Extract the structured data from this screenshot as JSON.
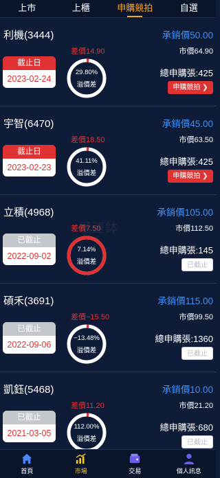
{
  "tabs": [
    {
      "label": "上市",
      "active": false
    },
    {
      "label": "上櫃",
      "active": false
    },
    {
      "label": "申購競拍",
      "active": true
    },
    {
      "label": "自選",
      "active": false
    }
  ],
  "labels": {
    "diff_prefix": "差價",
    "underwrite_prefix": "承銷價",
    "market_prefix": "市價",
    "total_prefix": "總申購張:",
    "ring_caption": "溢價差",
    "bid_button": "申購競拍 ❯",
    "closed_button": "已截止"
  },
  "watermark": "極速鉢",
  "colors": {
    "background": "#0f1c38",
    "bar": "#0a152c",
    "accent": "#f5a623",
    "red": "#e03232",
    "blue": "#3d8ff5",
    "ring_track": "#ffffff"
  },
  "items": [
    {
      "name": "利機(3444)",
      "status": "截止日",
      "closed": false,
      "date": "2023-02-24",
      "diff": "14.90",
      "premium": "29.80%",
      "premium_fraction": 0.02,
      "underwrite": "50.00",
      "market": "64.90",
      "total": "425",
      "button": "bid"
    },
    {
      "name": "宇智(6470)",
      "status": "截止日",
      "closed": false,
      "date": "2023-02-23",
      "diff": "18.50",
      "premium": "41.11%",
      "premium_fraction": 0.02,
      "underwrite": "45.00",
      "market": "63.50",
      "total": "425",
      "button": "bid"
    },
    {
      "name": "立積(4968)",
      "status": "已截止",
      "closed": true,
      "date": "2022-09-02",
      "diff": "7.50",
      "premium": "7.14%",
      "premium_fraction": 1.0,
      "underwrite": "105.00",
      "market": "112.50",
      "total": "145",
      "button": "closed"
    },
    {
      "name": "碩禾(3691)",
      "status": "已截止",
      "closed": true,
      "date": "2022-09-06",
      "diff": "−15.50",
      "premium": "−13.48%",
      "premium_fraction": 0.02,
      "underwrite": "115.00",
      "market": "99.50",
      "total": "1360",
      "button": "closed"
    },
    {
      "name": "凱鈺(5468)",
      "status": "已截止",
      "closed": true,
      "date": "2021-03-05",
      "diff": "11.20",
      "premium": "112.00%",
      "premium_fraction": 0.02,
      "underwrite": "10.00",
      "market": "21.20",
      "total": "680",
      "button": "closed"
    }
  ],
  "bottom_nav": [
    {
      "label": "首頁",
      "icon": "home-icon",
      "active": false
    },
    {
      "label": "市場",
      "icon": "chart-icon",
      "active": true
    },
    {
      "label": "交易",
      "icon": "wallet-icon",
      "active": false
    },
    {
      "label": "個人訊息",
      "icon": "user-icon",
      "active": false
    }
  ]
}
